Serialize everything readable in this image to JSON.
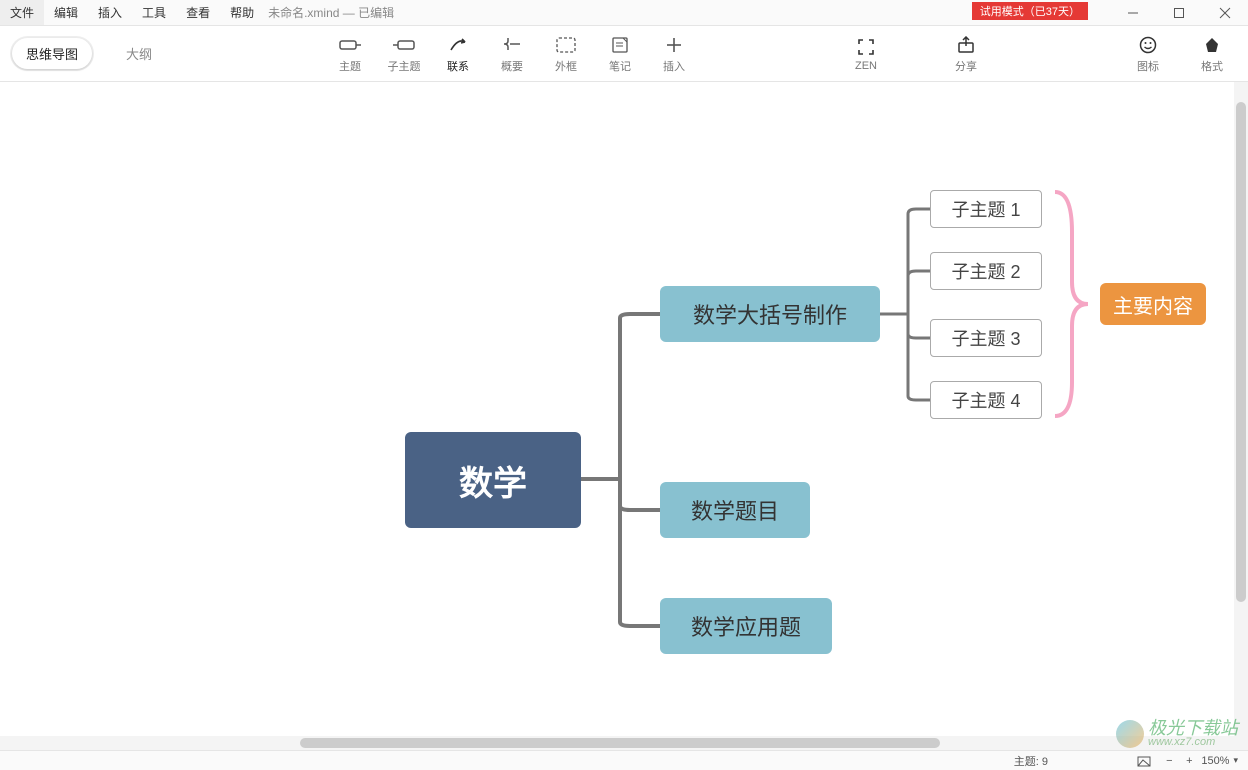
{
  "menu": {
    "file": "文件",
    "edit": "编辑",
    "insert": "插入",
    "tools": "工具",
    "view": "查看",
    "help": "帮助",
    "doc": "未命名.xmind  — 已编辑"
  },
  "trial": "试用模式（已37天）",
  "viewSwitch": {
    "mindmap": "思维导图",
    "outline": "大纲"
  },
  "tools": {
    "topic": "主题",
    "subtopic": "子主题",
    "relation": "联系",
    "summary": "概要",
    "boundary": "外框",
    "note": "笔记",
    "insert": "插入",
    "zen": "ZEN",
    "share": "分享",
    "iconlib": "图标",
    "format": "格式"
  },
  "map": {
    "root": "数学",
    "b1": "数学大括号制作",
    "b2": "数学题目",
    "b3": "数学应用题",
    "s1": "子主题 1",
    "s2": "子主题 2",
    "s3": "子主题 3",
    "s4": "子主题 4",
    "summary": "主要内容"
  },
  "status": {
    "topics_label": "主题:",
    "topics_count": "9",
    "zoom": "150%"
  },
  "watermark": {
    "text1": "极光下载站",
    "text2": "www.xz7.com"
  }
}
